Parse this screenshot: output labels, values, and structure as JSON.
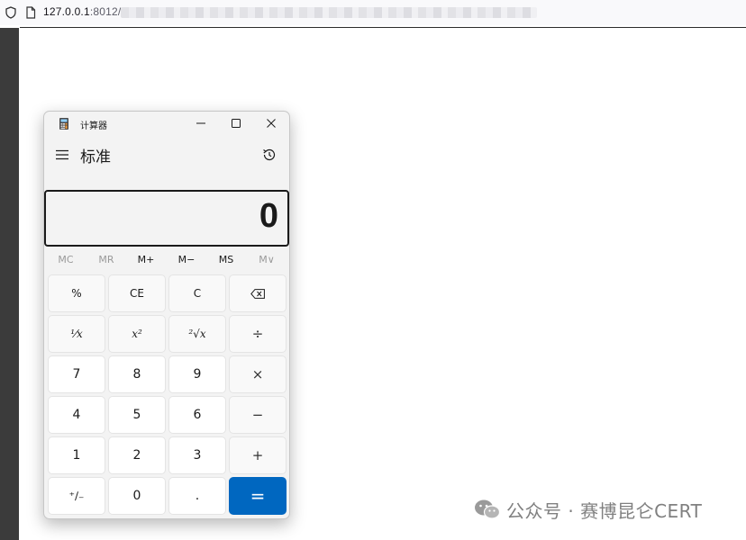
{
  "browser": {
    "url_host": "127.0.0.1",
    "url_port_path": ":8012/"
  },
  "calculator": {
    "window_title": "计算器",
    "mode_title": "标准",
    "display_value": "0",
    "memory_buttons": [
      {
        "label": "MC",
        "enabled": false
      },
      {
        "label": "MR",
        "enabled": false
      },
      {
        "label": "M+",
        "enabled": true
      },
      {
        "label": "M−",
        "enabled": true
      },
      {
        "label": "MS",
        "enabled": true
      },
      {
        "label": "M∨",
        "enabled": false
      }
    ],
    "keys": {
      "percent": "%",
      "clear_entry": "CE",
      "clear": "C",
      "backspace": "⌫",
      "reciprocal": "⅟x",
      "square": "x²",
      "sqrt": "²√x",
      "divide": "÷",
      "seven": "7",
      "eight": "8",
      "nine": "9",
      "multiply": "×",
      "four": "4",
      "five": "5",
      "six": "6",
      "minus": "−",
      "one": "1",
      "two": "2",
      "three": "3",
      "plus": "+",
      "negate": "⁺∕₋",
      "zero": "0",
      "decimal": ".",
      "equals": "="
    },
    "accent_color": "#0067c0"
  },
  "watermark": {
    "text": "公众号 · 赛博昆仑CERT"
  }
}
